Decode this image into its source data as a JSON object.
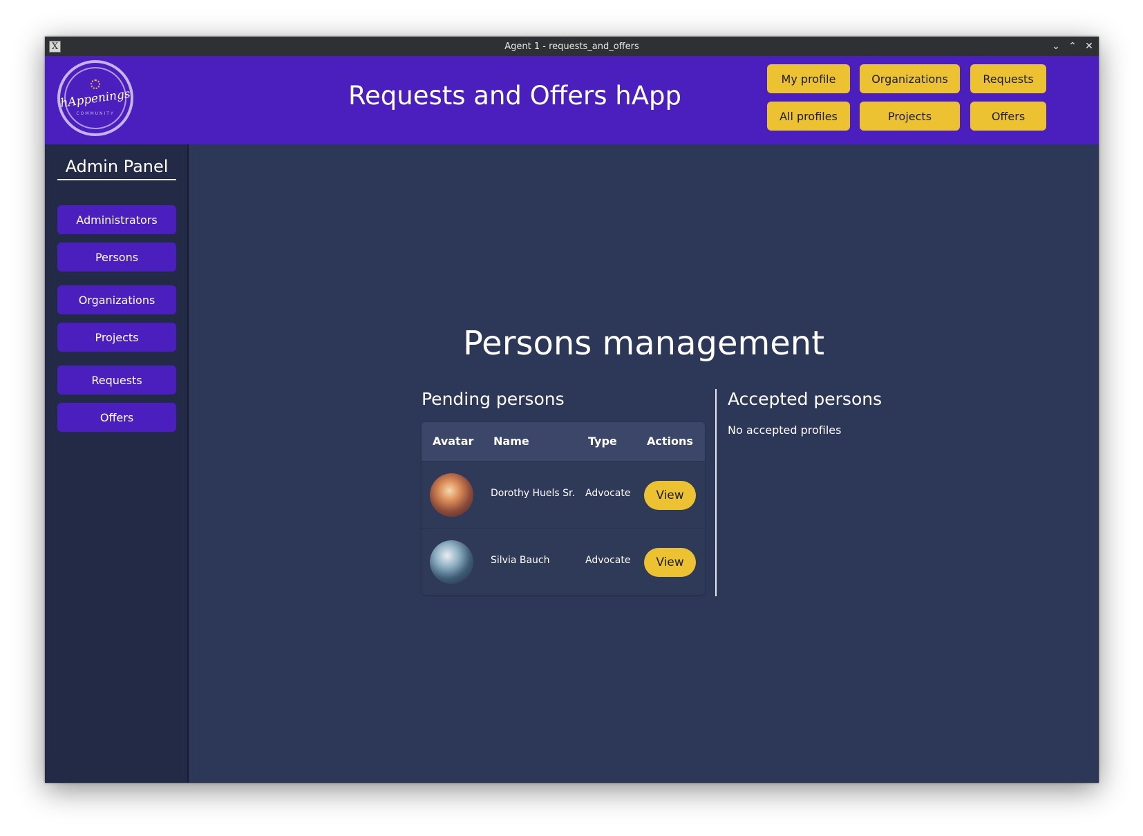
{
  "window": {
    "title": "Agent 1 - requests_and_offers"
  },
  "header": {
    "logo_text": "hAppenings",
    "logo_subtext": "COMMUNITY",
    "app_title": "Requests and Offers hApp",
    "nav": {
      "my_profile": "My profile",
      "organizations": "Organizations",
      "requests": "Requests",
      "all_profiles": "All profiles",
      "projects": "Projects",
      "offers": "Offers"
    }
  },
  "sidebar": {
    "title": "Admin Panel",
    "items": [
      {
        "label": "Administrators"
      },
      {
        "label": "Persons"
      },
      {
        "label": "Organizations"
      },
      {
        "label": "Projects"
      },
      {
        "label": "Requests"
      },
      {
        "label": "Offers"
      }
    ]
  },
  "main": {
    "title": "Persons management",
    "pending": {
      "title": "Pending persons",
      "columns": [
        "Avatar",
        "Name",
        "Type",
        "Actions"
      ],
      "rows": [
        {
          "name": "Dorothy Huels Sr.",
          "type": "Advocate",
          "action": "View"
        },
        {
          "name": "Silvia Bauch",
          "type": "Advocate",
          "action": "View"
        }
      ]
    },
    "accepted": {
      "title": "Accepted persons",
      "empty_text": "No accepted profiles"
    }
  },
  "colors": {
    "brand_purple": "#4a1fbe",
    "accent_yellow": "#ecc232",
    "content_bg": "#2d3757",
    "sidebar_bg": "#232a45"
  }
}
